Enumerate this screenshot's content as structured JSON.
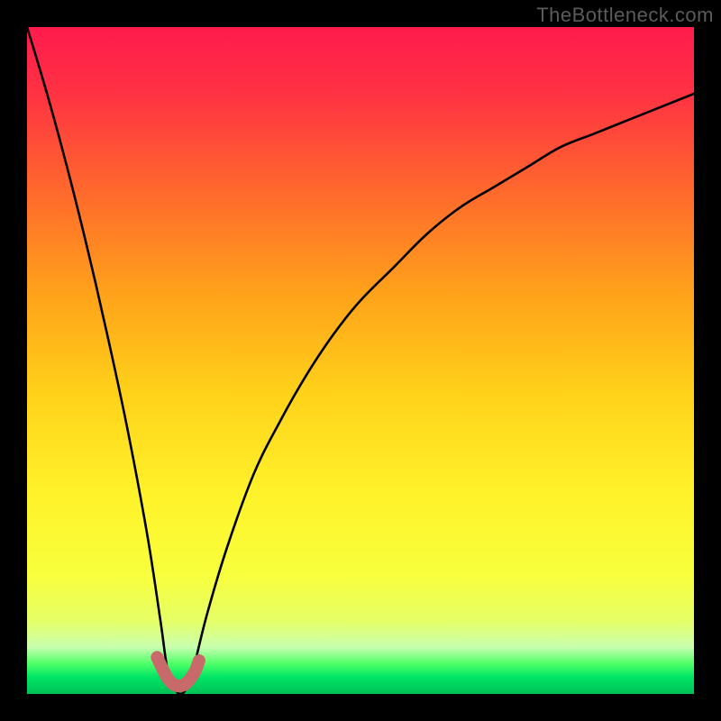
{
  "watermark": "TheBottleneck.com",
  "gradient": {
    "stops": [
      {
        "offset": 0.0,
        "color": "#ff1b4d"
      },
      {
        "offset": 0.1,
        "color": "#ff3243"
      },
      {
        "offset": 0.25,
        "color": "#ff6a2c"
      },
      {
        "offset": 0.4,
        "color": "#ffa21a"
      },
      {
        "offset": 0.55,
        "color": "#ffd21a"
      },
      {
        "offset": 0.7,
        "color": "#fff22a"
      },
      {
        "offset": 0.82,
        "color": "#f8ff3c"
      },
      {
        "offset": 0.89,
        "color": "#e6ff66"
      },
      {
        "offset": 0.93,
        "color": "#c8ffb0"
      },
      {
        "offset": 0.955,
        "color": "#4dff66"
      },
      {
        "offset": 0.975,
        "color": "#00e566"
      },
      {
        "offset": 1.0,
        "color": "#00c055"
      }
    ]
  },
  "chart_data": {
    "type": "line",
    "title": "",
    "xlabel": "",
    "ylabel": "",
    "xlim": [
      0,
      100
    ],
    "ylim": [
      0,
      100
    ],
    "mismatch_percent_at_x": "V-shaped bottleneck curve: minimum (best match) near x≈21–24 where y≈0; left branch rises steeply to y≈100 at x=0; right branch rises with decreasing slope to y≈90 at x=100.",
    "series": [
      {
        "name": "bottleneck-curve",
        "x": [
          0,
          3,
          6,
          9,
          12,
          15,
          18,
          20,
          21,
          22,
          23,
          24,
          25,
          27,
          30,
          34,
          38,
          42,
          46,
          50,
          55,
          60,
          65,
          70,
          75,
          80,
          85,
          90,
          95,
          100
        ],
        "y": [
          100,
          90,
          79,
          67,
          54,
          40,
          24,
          11,
          4,
          1,
          0,
          1,
          4,
          12,
          22,
          33,
          41,
          48,
          54,
          59,
          64,
          69,
          73,
          76,
          79,
          82,
          84,
          86,
          88,
          90
        ]
      }
    ],
    "highlight": {
      "name": "optimal-zone-marker",
      "color": "#c96a6a",
      "x": [
        19.5,
        20.5,
        21.2,
        22.0,
        22.8,
        23.6,
        24.4,
        25.2,
        25.8
      ],
      "y": [
        5.5,
        3.4,
        2.2,
        1.4,
        1.2,
        1.4,
        2.2,
        3.4,
        5.0
      ]
    }
  }
}
